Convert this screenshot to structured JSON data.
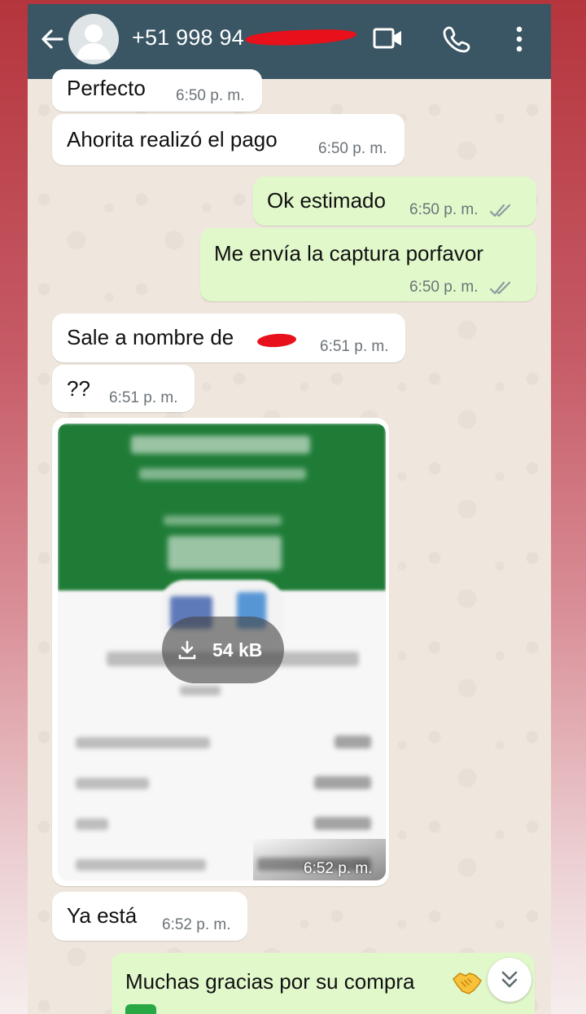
{
  "header": {
    "contact": "+51 998 94",
    "back_icon": "arrow-left-icon",
    "video_icon": "video-camera-icon",
    "call_icon": "phone-icon",
    "menu_icon": "more-vertical-icon",
    "bg_color": "#3a5564"
  },
  "messages": [
    {
      "direction": "in",
      "text": "Perfecto",
      "time": "6:50 p. m."
    },
    {
      "direction": "in",
      "text": "Ahorita realizó el pago",
      "time": "6:50 p. m."
    },
    {
      "direction": "out",
      "text": "Ok estimado",
      "time": "6:50 p. m.",
      "status": "read"
    },
    {
      "direction": "out",
      "text": "Me envía la captura porfavor",
      "time": "6:50 p. m.",
      "status": "read"
    },
    {
      "direction": "in",
      "text": "Sale a nombre de",
      "time": "6:51 p. m."
    },
    {
      "direction": "in",
      "text": "??",
      "time": "6:51 p. m."
    },
    {
      "direction": "in",
      "type": "image",
      "download_size": "54 kB",
      "time": "6:52 p. m."
    },
    {
      "direction": "in",
      "text": "Ya está",
      "time": "6:52 p. m."
    },
    {
      "direction": "out",
      "text": "Muchas gracias por su compra",
      "emoji": "handshake"
    }
  ],
  "scroll_button_icon": "double-chevron-down-icon",
  "colors": {
    "incoming_bubble": "#ffffff",
    "outgoing_bubble": "#e1f8cb",
    "read_ticks": "#8e9aa0",
    "chat_bg": "#efe7dd"
  }
}
